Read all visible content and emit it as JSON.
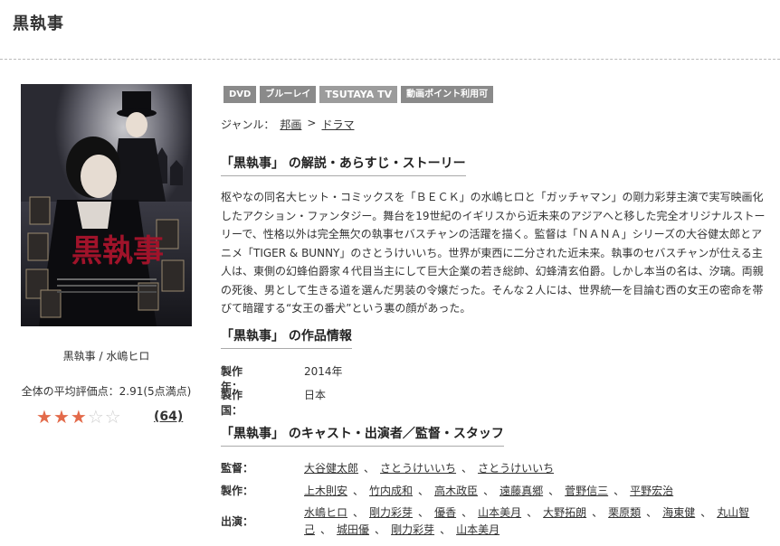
{
  "page": {
    "title": "黒執事"
  },
  "left": {
    "caption": "黒執事 / 水嶋ヒロ",
    "rating_label": "全体の平均評価点：2.91(5点満点)",
    "stars_filled": 3,
    "stars_total": 5,
    "review_count": "(64)"
  },
  "badges": [
    "DVD",
    "ブルーレイ",
    "TSUTAYA TV",
    "動画ポイント利用可"
  ],
  "genre": {
    "label": "ジャンル：",
    "items": [
      "邦画",
      "ドラマ"
    ],
    "separator": ">"
  },
  "sections": {
    "synopsis_title": "「黒執事」 の解説・あらすじ・ストーリー",
    "info_title": "「黒執事」 の作品情報",
    "cast_title": "「黒執事」 のキャスト・出演者／監督・スタッフ"
  },
  "synopsis": "枢やなの同名大ヒット・コミックスを「ＢＥＣＫ」の水嶋ヒロと「ガッチャマン」の剛力彩芽主演で実写映画化したアクション・ファンタジー。舞台を19世紀のイギリスから近未来のアジアへと移した完全オリジナルストーリーで、性格以外は完全無欠の執事セバスチャンの活躍を描く。監督は「ＮＡＮＡ」シリーズの大谷健太郎とアニメ「TIGER & BUNNY」のさとうけいいち。世界が東西に二分された近未来。執事のセバスチャンが仕える主人は、東側の幻蜂伯爵家４代目当主にして巨大企業の若き総帥、幻蜂清玄伯爵。しかし本当の名は、汐璃。両親の死後、男として生きる道を選んだ男装の令嬢だった。そんな２人には、世界統一を目論む西の女王の密命を帯びて暗躍する“女王の番犬”という裏の顔があった。",
  "info": [
    {
      "key": "製作年：",
      "value": "2014年"
    },
    {
      "key": "製作国：",
      "value": "日本"
    }
  ],
  "credits": {
    "director": {
      "label": "監督：",
      "names": [
        "大谷健太郎",
        "さとうけいいち",
        "さとうけいいち"
      ]
    },
    "production": {
      "label": "製作：",
      "names": [
        "上木則安",
        "竹内成和",
        "高木政臣",
        "遠藤真郷",
        "菅野信三",
        "平野宏治"
      ]
    },
    "cast": {
      "label": "出演：",
      "names": [
        "水嶋ヒロ",
        "剛力彩芽",
        "優香",
        "山本美月",
        "大野拓朗",
        "栗原類",
        "海東健",
        "丸山智己",
        "城田優",
        "剛力彩芽",
        "山本美月"
      ]
    },
    "separator": "、"
  },
  "colors": {
    "star_on": "#e36a4a",
    "star_off": "#cfcfcf",
    "badge": "#8a8a8a"
  }
}
